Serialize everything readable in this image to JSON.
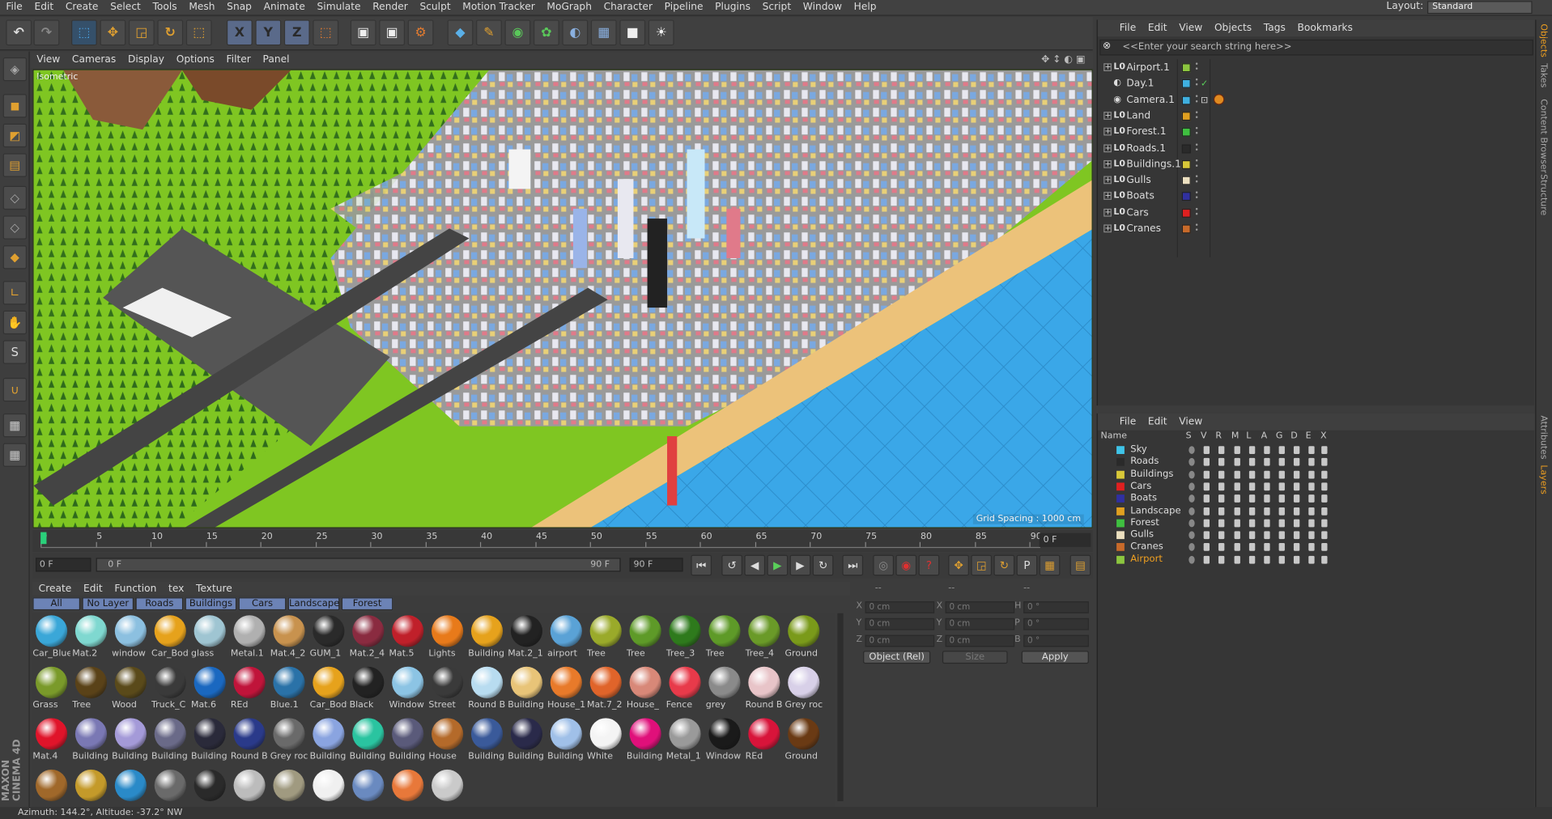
{
  "menubar": [
    "File",
    "Edit",
    "Create",
    "Select",
    "Tools",
    "Mesh",
    "Snap",
    "Animate",
    "Simulate",
    "Render",
    "Sculpt",
    "Motion Tracker",
    "MoGraph",
    "Character",
    "Pipeline",
    "Plugins",
    "Script",
    "Window",
    "Help"
  ],
  "layout": {
    "label": "Layout:",
    "value": "Standard"
  },
  "toolbar": {
    "x": "X",
    "y": "Y",
    "z": "Z"
  },
  "viewport": {
    "menu": [
      "View",
      "Cameras",
      "Display",
      "Options",
      "Filter",
      "Panel"
    ],
    "label": "Isometric",
    "grid_spacing": "Grid Spacing : 1000 cm"
  },
  "timeline": {
    "ticks": [
      "0",
      "5",
      "10",
      "15",
      "20",
      "25",
      "30",
      "35",
      "40",
      "45",
      "50",
      "55",
      "60",
      "65",
      "70",
      "75",
      "80",
      "85",
      "90"
    ],
    "current": "0 F"
  },
  "transport": {
    "start": "0 F",
    "range_start": "0 F",
    "range_end": "90 F",
    "end": "90 F"
  },
  "material_menu": [
    "Create",
    "Edit",
    "Function",
    "tex",
    "Texture"
  ],
  "material_tabs": [
    "All",
    "No Layer",
    "Roads",
    "Buildings",
    "Cars",
    "Landscape",
    "Forest"
  ],
  "materials": [
    {
      "name": "Car_Blue",
      "color": "#3aa7d8"
    },
    {
      "name": "Mat.2",
      "color": "#7fd8d0"
    },
    {
      "name": "window",
      "color": "#8cc0e0"
    },
    {
      "name": "Car_Body",
      "color": "#e6a21c"
    },
    {
      "name": "glass",
      "color": "#9fc5d2"
    },
    {
      "name": "Metal.1",
      "color": "#b0b0b0"
    },
    {
      "name": "Mat.4_2",
      "color": "#c8924e"
    },
    {
      "name": "GUM_1",
      "color": "#2a2a2a"
    },
    {
      "name": "Mat.2_4",
      "color": "#8a2b40"
    },
    {
      "name": "Mat.5",
      "color": "#c0202a"
    },
    {
      "name": "Lights",
      "color": "#e87a1a"
    },
    {
      "name": "Building",
      "color": "#e6a21c"
    },
    {
      "name": "Mat.2_1",
      "color": "#222222"
    },
    {
      "name": "airport",
      "color": "#5aa2d6"
    },
    {
      "name": "Tree",
      "color": "#9aaa2a"
    },
    {
      "name": "Tree",
      "color": "#5e9a28"
    },
    {
      "name": "Tree_3",
      "color": "#2e7a1c"
    },
    {
      "name": "Tree",
      "color": "#5e9a28"
    },
    {
      "name": "Tree_4",
      "color": "#6a9a28"
    },
    {
      "name": "Ground",
      "color": "#7a9a1a"
    },
    {
      "name": "Grass",
      "color": "#7a9a2a"
    },
    {
      "name": "Tree",
      "color": "#5a4218"
    },
    {
      "name": "Wood",
      "color": "#5a4a1a"
    },
    {
      "name": "Truck_C",
      "color": "#3a3a3a"
    },
    {
      "name": "Mat.6",
      "color": "#1a68c0"
    },
    {
      "name": "REd",
      "color": "#c0143a"
    },
    {
      "name": "Blue.1",
      "color": "#2a72a8"
    },
    {
      "name": "Car_Body",
      "color": "#e6a21c"
    },
    {
      "name": "Black",
      "color": "#222222"
    },
    {
      "name": "Window",
      "color": "#8cc4e4"
    },
    {
      "name": "Street",
      "color": "#3a3a3a"
    },
    {
      "name": "Round B",
      "color": "#b8dcf0"
    },
    {
      "name": "Building",
      "color": "#e8c478"
    },
    {
      "name": "House_1",
      "color": "#e87a2a"
    },
    {
      "name": "Mat.7_2",
      "color": "#e0642a"
    },
    {
      "name": "House_",
      "color": "#d88878"
    },
    {
      "name": "Fence",
      "color": "#e83a4a"
    },
    {
      "name": "grey",
      "color": "#8a8a8a"
    },
    {
      "name": "Round B",
      "color": "#e8c4c8"
    },
    {
      "name": "Grey roc",
      "color": "#d8d0e8"
    },
    {
      "name": "Mat.4",
      "color": "#e0142a"
    },
    {
      "name": "Building",
      "color": "#7a78b4"
    },
    {
      "name": "Building",
      "color": "#a49ad8"
    },
    {
      "name": "Building",
      "color": "#6a6a88"
    },
    {
      "name": "Building",
      "color": "#2a2a3a"
    },
    {
      "name": "Round B",
      "color": "#2a3a8a"
    },
    {
      "name": "Grey roc",
      "color": "#6a6a6a"
    },
    {
      "name": "Building",
      "color": "#8aa4e0"
    },
    {
      "name": "Building",
      "color": "#2ac4a0"
    },
    {
      "name": "Building",
      "color": "#5a5a7a"
    },
    {
      "name": "House",
      "color": "#b46a2a"
    },
    {
      "name": "Building",
      "color": "#3a5a9a"
    },
    {
      "name": "Building",
      "color": "#2a2a4a"
    },
    {
      "name": "Building",
      "color": "#a0c0e8"
    },
    {
      "name": "White",
      "color": "#f4f4f4"
    },
    {
      "name": "Building",
      "color": "#e0107a"
    },
    {
      "name": "Metal_1",
      "color": "#9a9a9a"
    },
    {
      "name": "Window",
      "color": "#1a1a1a"
    },
    {
      "name": "REd",
      "color": "#d8143a"
    },
    {
      "name": "Ground",
      "color": "#6a3a14"
    },
    {
      "name": "",
      "color": "#a0682a"
    },
    {
      "name": "",
      "color": "#c49a2a"
    },
    {
      "name": "",
      "color": "#2a8ac8"
    },
    {
      "name": "",
      "color": "#6a6a6a"
    },
    {
      "name": "",
      "color": "#2a2a2a"
    },
    {
      "name": "",
      "color": "#bcbcbc"
    },
    {
      "name": "",
      "color": "#a09a80"
    },
    {
      "name": "",
      "color": "#f0f0f0"
    },
    {
      "name": "",
      "color": "#6a8ac0"
    },
    {
      "name": "",
      "color": "#e8783a"
    },
    {
      "name": "",
      "color": "#cacaca"
    }
  ],
  "attributes": {
    "rows": [
      {
        "a": "X",
        "av": "0 cm",
        "b": "X",
        "bv": "0 cm",
        "c": "H",
        "cv": "0 °"
      },
      {
        "a": "Y",
        "av": "0 cm",
        "b": "Y",
        "bv": "0 cm",
        "c": "P",
        "cv": "0 °"
      },
      {
        "a": "Z",
        "av": "0 cm",
        "b": "Z",
        "bv": "0 cm",
        "c": "B",
        "cv": "0 °"
      }
    ],
    "mode": "Object (Rel)",
    "size": "Size",
    "apply": "Apply",
    "dashes": [
      "--",
      "--",
      "--"
    ]
  },
  "object_manager": {
    "menu": [
      "File",
      "Edit",
      "View",
      "Objects",
      "Tags",
      "Bookmarks"
    ],
    "search": "<<Enter your search string here>>",
    "objects": [
      {
        "name": "Airport.1",
        "color": "#8cc63f"
      },
      {
        "name": "Day.1",
        "color": "#3fb0e0"
      },
      {
        "name": "Camera.1",
        "color": "#3fb0e0"
      },
      {
        "name": "Land",
        "color": "#e0a020"
      },
      {
        "name": "Forest.1",
        "color": "#3fc040"
      },
      {
        "name": "Roads.1",
        "color": "#2a2a2a"
      },
      {
        "name": "Buildings.1",
        "color": "#d8c838"
      },
      {
        "name": "Gulls",
        "color": "#ece0c0"
      },
      {
        "name": "Boats",
        "color": "#3030a0"
      },
      {
        "name": "Cars",
        "color": "#e02020"
      },
      {
        "name": "Cranes",
        "color": "#c86a2a"
      }
    ]
  },
  "layer_manager": {
    "menu": [
      "File",
      "Edit",
      "View"
    ],
    "headers": [
      "Name",
      "S",
      "V",
      "R",
      "M",
      "L",
      "A",
      "G",
      "D",
      "E",
      "X"
    ],
    "layers": [
      {
        "name": "Sky",
        "color": "#3fc4e8"
      },
      {
        "name": "Roads",
        "color": "#2a2a2a"
      },
      {
        "name": "Buildings",
        "color": "#d8c838"
      },
      {
        "name": "Cars",
        "color": "#e02020"
      },
      {
        "name": "Boats",
        "color": "#3030a0"
      },
      {
        "name": "Landscape",
        "color": "#e0a020"
      },
      {
        "name": "Forest",
        "color": "#3fc040"
      },
      {
        "name": "Gulls",
        "color": "#ece0c0"
      },
      {
        "name": "Cranes",
        "color": "#c86a2a"
      },
      {
        "name": "Airport",
        "color": "#8cc63f"
      }
    ]
  },
  "right_tabs": [
    "Objects",
    "Takes",
    "Content Browser",
    "Structure",
    "Attributes",
    "Layers"
  ],
  "status": "Azimuth: 144.2°, Altitude: -37.2°  NW",
  "brand": "MAXON CINEMA 4D"
}
